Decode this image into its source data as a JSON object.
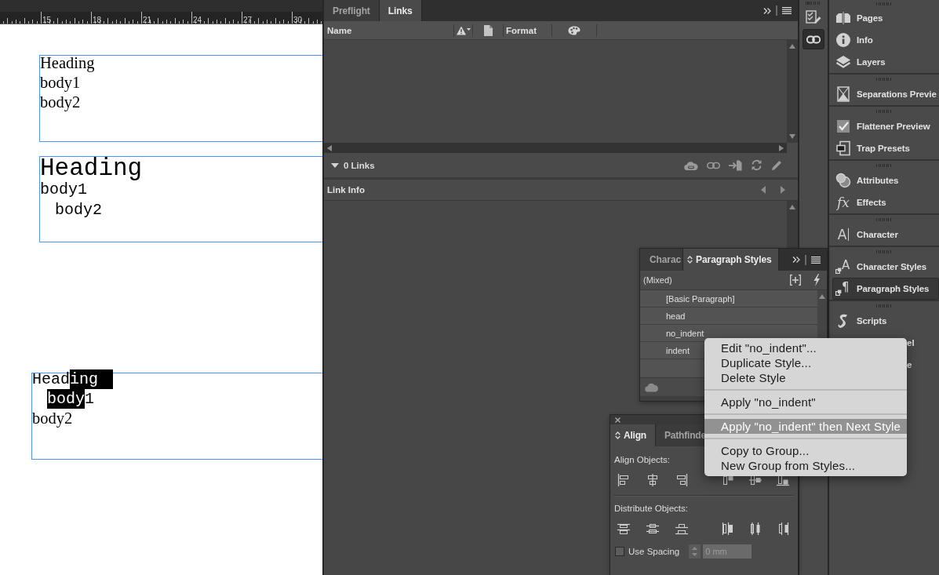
{
  "ruler": {
    "labels": [
      "15",
      "18",
      "21",
      "24",
      "27",
      "30"
    ]
  },
  "canvas": {
    "frames": [
      {
        "lines": [
          {
            "kind": "serif",
            "runs": [
              {
                "text": "Heading",
                "selected": false
              }
            ]
          },
          {
            "kind": "serif",
            "runs": [
              {
                "text": "body1",
                "selected": false
              }
            ]
          },
          {
            "kind": "serif",
            "runs": [
              {
                "text": "body2",
                "selected": false
              }
            ]
          }
        ]
      },
      {
        "lines": [
          {
            "kind": "mono-large",
            "runs": [
              {
                "text": "Heading",
                "selected": false
              }
            ]
          },
          {
            "kind": "mono",
            "runs": [
              {
                "text": "body1",
                "selected": false
              }
            ]
          },
          {
            "kind": "mono-indent",
            "runs": [
              {
                "text": "body2",
                "selected": false
              }
            ]
          }
        ]
      },
      {
        "lines": [
          {
            "kind": "mono",
            "runs": [
              {
                "text": "Head",
                "selected": false
              },
              {
                "text": "ing",
                "selected": true
              }
            ]
          },
          {
            "kind": "mono-indent",
            "runs": [
              {
                "text": "body",
                "selected": true
              },
              {
                "text": "1",
                "selected": false
              }
            ]
          },
          {
            "kind": "serif",
            "runs": [
              {
                "text": "body2",
                "selected": false
              }
            ]
          }
        ]
      }
    ]
  },
  "links_panel": {
    "tabs": [
      {
        "label": "Preflight",
        "selected": false
      },
      {
        "label": "Links",
        "selected": true
      }
    ],
    "name_column": "Name",
    "format_column": "Format",
    "footer": {
      "expanded": true,
      "count": "0 Links"
    },
    "link_info": "Link Info"
  },
  "icon_column": {
    "buttons": [
      {
        "selected": false
      },
      {
        "selected": true
      }
    ]
  },
  "dock": {
    "groups": [
      {
        "items": [
          {
            "kind": "entry",
            "label": "Pages",
            "selected": false
          },
          {
            "kind": "entry",
            "label": "Info",
            "selected": false
          },
          {
            "kind": "entry",
            "label": "Layers",
            "selected": false
          }
        ]
      },
      {
        "items": [
          {
            "kind": "entry",
            "label": "Separations Previe",
            "selected": false
          }
        ]
      },
      {
        "items": [
          {
            "kind": "entry",
            "label": "Flattener Preview",
            "selected": false
          },
          {
            "kind": "entry",
            "label": "Trap Presets",
            "selected": false
          }
        ]
      },
      {
        "items": [
          {
            "kind": "entry",
            "label": "Attributes",
            "selected": false
          },
          {
            "kind": "entry",
            "label": "Effects",
            "glyph": "fx",
            "selected": false
          }
        ]
      },
      {
        "items": [
          {
            "kind": "entry",
            "label": "Character",
            "glyph": "A",
            "selected": false
          }
        ]
      },
      {
        "items": [
          {
            "kind": "entry",
            "label": "Character Styles",
            "glyph": "A",
            "selected": false
          },
          {
            "kind": "entry",
            "label": "Paragraph Styles",
            "glyph": "¶",
            "selected": true
          }
        ]
      },
      {
        "items": [
          {
            "kind": "entry",
            "label": "Scripts",
            "selected": false
          },
          {
            "kind": "clipped",
            "label": "el",
            "selected": false
          },
          {
            "kind": "clipped",
            "label": "e",
            "selected": false
          }
        ]
      }
    ]
  },
  "paragraph_styles_panel": {
    "tabs": [
      {
        "label": "Charac",
        "selected": false
      },
      {
        "label": "Paragraph Styles",
        "selected": true
      }
    ],
    "current_style": "(Mixed)",
    "styles": [
      "[Basic Paragraph]",
      "head",
      "no_indent",
      "indent"
    ]
  },
  "align_panel": {
    "tabs": [
      {
        "label": "Align",
        "selected": true
      },
      {
        "label": "Pathfinde",
        "selected": false
      }
    ],
    "align_objects_label": "Align Objects:",
    "distribute_objects_label": "Distribute Objects:",
    "use_spacing": {
      "label": "Use Spacing",
      "checked": false
    },
    "spacing_field": {
      "value": "0 mm",
      "disabled": true
    }
  },
  "context_menu": {
    "items": [
      {
        "kind": "item",
        "label": "Edit \"no_indent\"...",
        "selected": false
      },
      {
        "kind": "item",
        "label": "Duplicate Style...",
        "selected": false
      },
      {
        "kind": "item",
        "label": "Delete Style",
        "selected": false
      },
      {
        "kind": "separator"
      },
      {
        "kind": "item",
        "label": "Apply \"no_indent\"",
        "selected": false
      },
      {
        "kind": "separator"
      },
      {
        "kind": "item",
        "label": "Apply \"no_indent\" then Next Style",
        "selected": true
      },
      {
        "kind": "separator"
      },
      {
        "kind": "item",
        "label": "Copy to Group...",
        "selected": false
      },
      {
        "kind": "item",
        "label": "New Group from Styles...",
        "selected": false
      }
    ]
  }
}
